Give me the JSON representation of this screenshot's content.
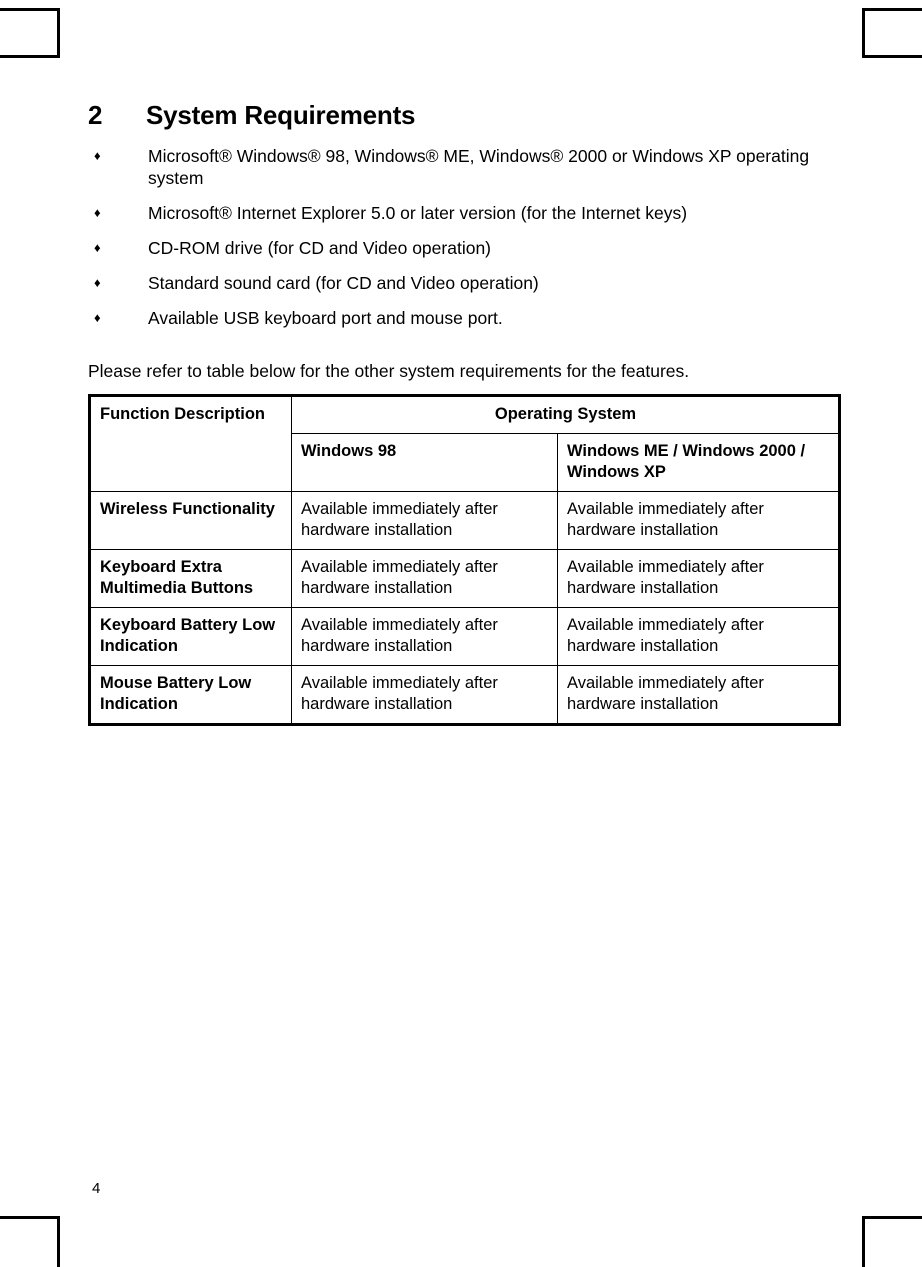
{
  "page": {
    "number": "4"
  },
  "heading": {
    "number": "2",
    "title": "System Requirements"
  },
  "requirements": [
    {
      "bullet": "diamond-bullet",
      "text": "Microsoft® Windows® 98, Windows® ME, Windows® 2000 or Windows XP operating system"
    },
    {
      "bullet": "diamond-bullet",
      "text": "Microsoft® Internet Explorer 5.0 or later version (for the Internet keys)"
    },
    {
      "bullet": "diamond-bullet",
      "text": "CD-ROM drive (for CD and Video operation)"
    },
    {
      "bullet": "diamond-bullet",
      "text": "Standard sound card (for CD and Video operation)"
    },
    {
      "bullet": "diamond-bullet",
      "text": "Available USB keyboard port and mouse port."
    }
  ],
  "intro_paragraph": "Please refer to table below for the other system requirements for the features.",
  "table": {
    "header": {
      "function_description": "Function Description",
      "operating_system": "Operating System",
      "col_windows98": "Windows 98",
      "col_windows_other_line1": "Windows ME / Windows 2000 /",
      "col_windows_other_line2": "Windows XP"
    },
    "rows": [
      {
        "feature": "Wireless Functionality",
        "windows98": "Available immediately after hardware installation",
        "windows_other": "Available immediately after hardware installation"
      },
      {
        "feature": "Keyboard Extra Multimedia Buttons",
        "windows98": "Available immediately after hardware installation",
        "windows_other": "Available immediately after hardware installation"
      },
      {
        "feature": "Keyboard Battery Low Indication",
        "windows98": "Available immediately after hardware installation",
        "windows_other": "Available immediately after hardware installation"
      },
      {
        "feature": "Mouse Battery Low Indication",
        "windows98": "Available immediately after hardware installation",
        "windows_other": "Available immediately after hardware installation"
      }
    ]
  },
  "glyphs": {
    "bullet": "♦"
  },
  "colors": {
    "shaded_cell": "#E3E3E3",
    "border": "#000000",
    "text": "#000000",
    "page_background": "#FFFFFF"
  }
}
